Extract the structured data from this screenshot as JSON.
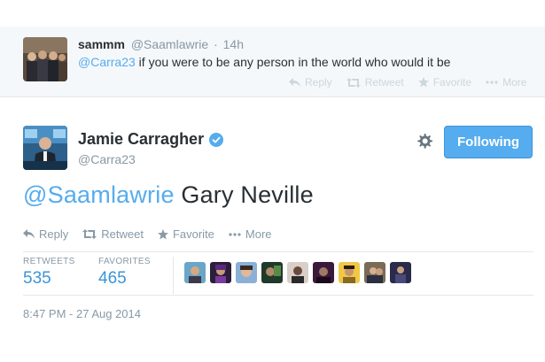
{
  "reply_tweet": {
    "display_name": "sammm",
    "handle": "@Saamlawrie",
    "separator": "·",
    "time": "14h",
    "mention": "@Carra23",
    "text": " if you were to be any person in the world who would it be",
    "actions": {
      "reply": "Reply",
      "retweet": "Retweet",
      "favorite": "Favorite",
      "more": "More"
    }
  },
  "main_tweet": {
    "display_name": "Jamie Carragher",
    "handle": "@Carra23",
    "verified": true,
    "follow_label": "Following",
    "mention": "@Saamlawrie",
    "text": " Gary Neville",
    "actions": {
      "reply": "Reply",
      "retweet": "Retweet",
      "favorite": "Favorite",
      "more": "More"
    },
    "stats": {
      "retweets_label": "RETWEETS",
      "retweets_value": "535",
      "favorites_label": "FAVORITES",
      "favorites_value": "465"
    },
    "favoriter_avatar_count": 9,
    "timestamp": "8:47 PM - 27 Aug 2014"
  },
  "colors": {
    "accent": "#55acee",
    "link": "#3b94d9",
    "muted": "#8899a6",
    "reply_bg": "#f5f8fa"
  },
  "icons": [
    "reply-icon",
    "retweet-icon",
    "favorite-star-icon",
    "more-dots-icon",
    "gear-icon",
    "verified-badge-icon"
  ]
}
